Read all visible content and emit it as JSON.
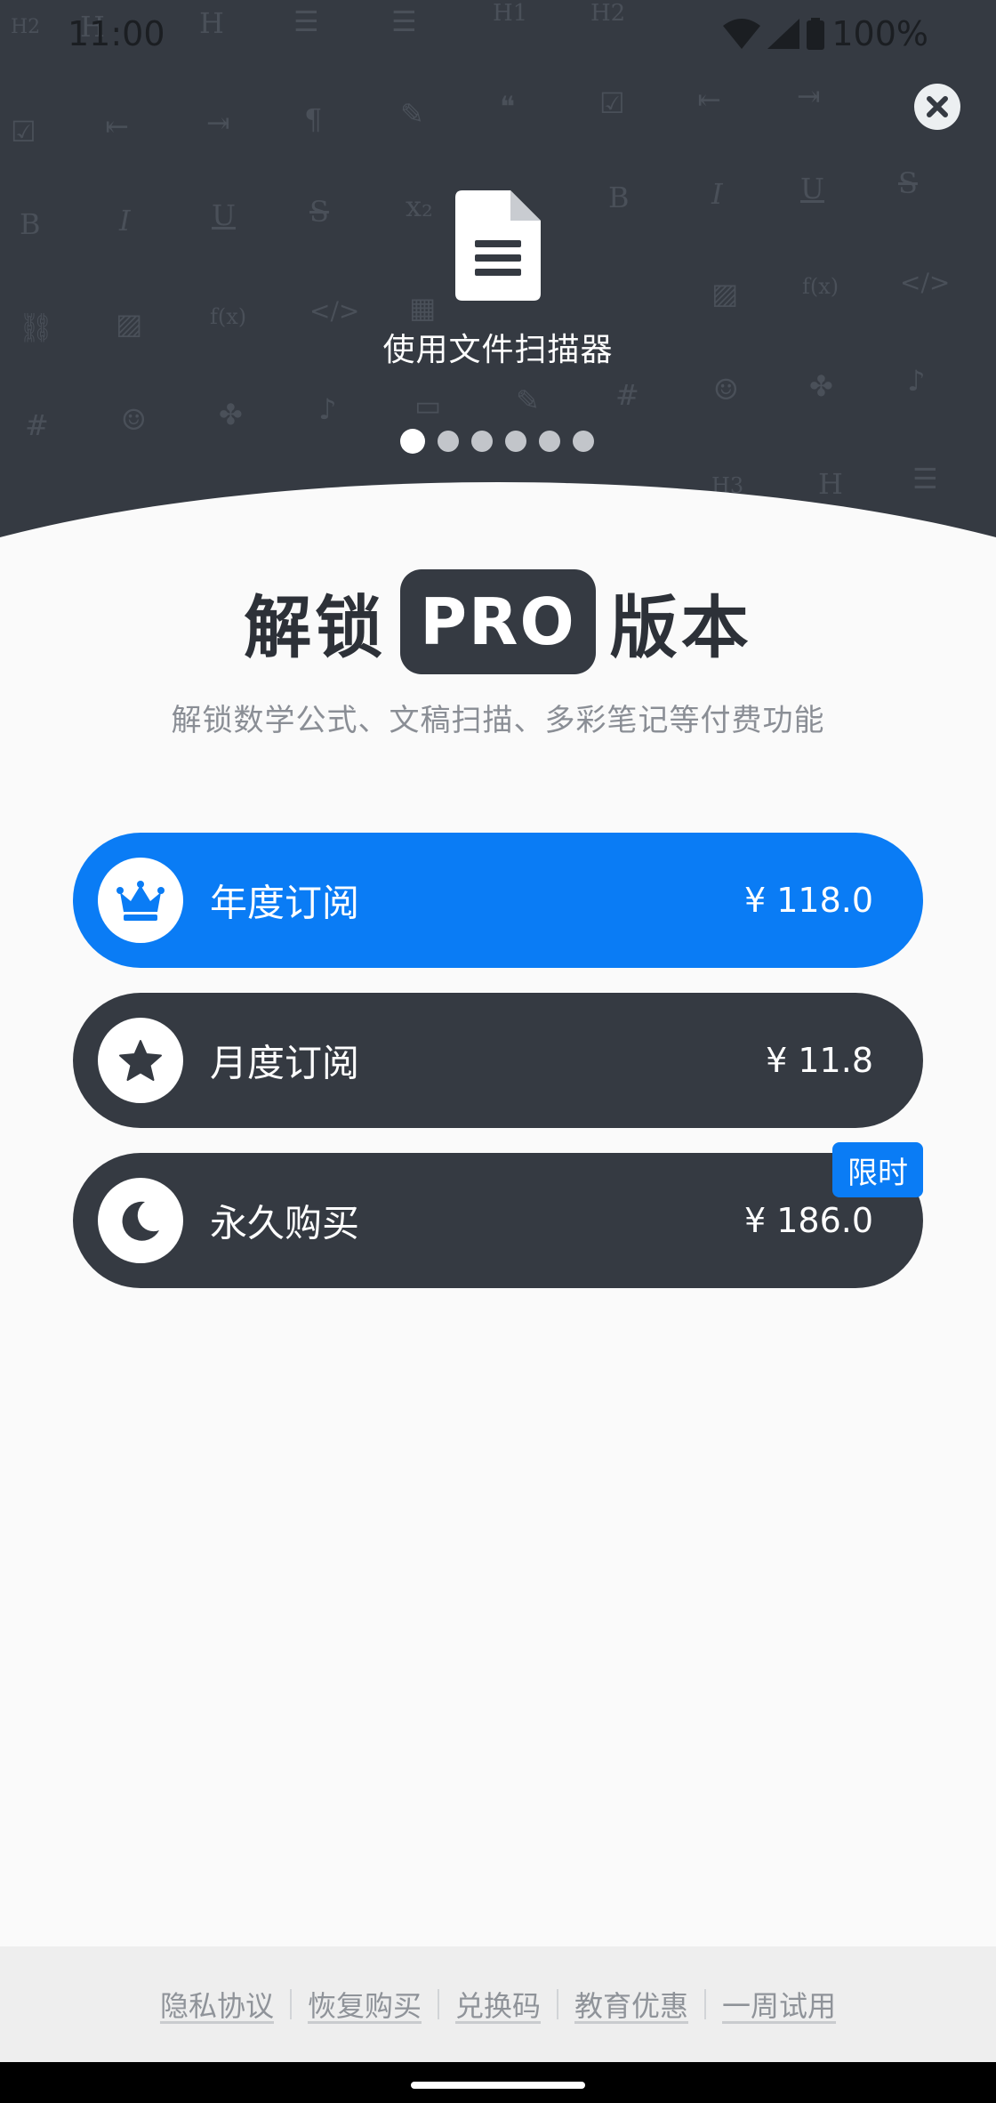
{
  "status_bar": {
    "time": "11:00",
    "battery": "100%",
    "wifi_icon": "wifi-icon",
    "signal_icon": "signal-icon",
    "battery_icon": "battery-icon"
  },
  "header": {
    "close_icon": "close-icon",
    "feature_icon": "document-icon",
    "feature_caption": "使用文件扫描器",
    "pager": {
      "count": 6,
      "active_index": 0
    }
  },
  "title": {
    "prefix": "解锁",
    "badge": "PRO",
    "suffix": "版本",
    "subtitle": "解锁数学公式、文稿扫描、多彩笔记等付费功能"
  },
  "plans": [
    {
      "name": "年度订阅",
      "price": "¥ 118.0",
      "icon": "crown-icon",
      "selected": true
    },
    {
      "name": "月度订阅",
      "price": "¥ 11.8",
      "icon": "star-icon",
      "selected": false
    },
    {
      "name": "永久购买",
      "price": "¥ 186.0",
      "icon": "moon-icon",
      "selected": false,
      "badge": "限时"
    }
  ],
  "footer": {
    "links": [
      "隐私协议",
      "恢复购买",
      "兑换码",
      "教育优惠",
      "一周试用"
    ]
  },
  "colors": {
    "dark": "#353a42",
    "accent": "#0a7cf5",
    "background": "#fafafa"
  }
}
